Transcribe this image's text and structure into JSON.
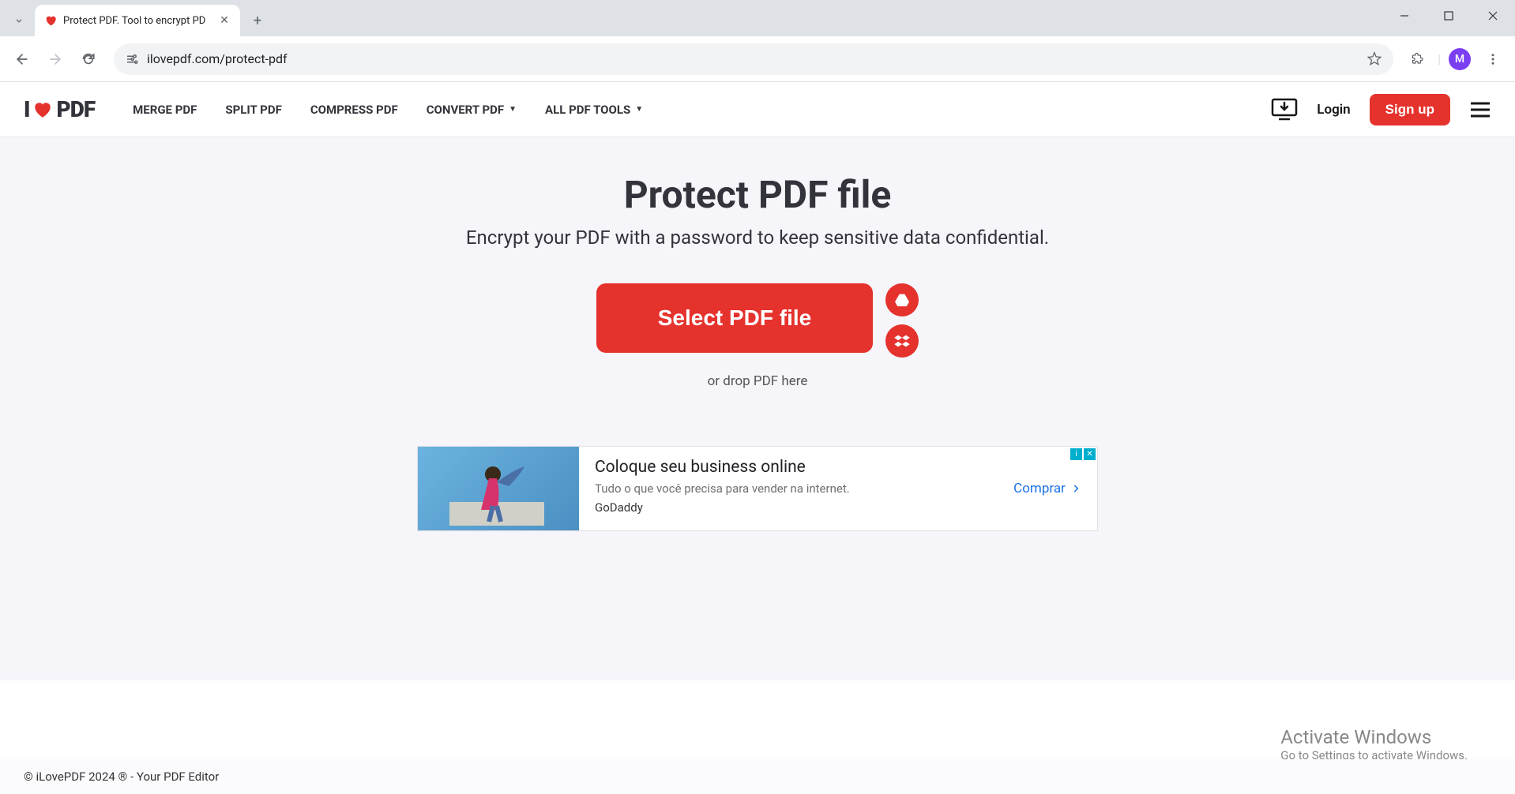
{
  "browser": {
    "tab_title": "Protect PDF. Tool to encrypt PD",
    "url": "ilovepdf.com/protect-pdf",
    "profile_initial": "M"
  },
  "header": {
    "logo_prefix": "I",
    "logo_suffix": "PDF",
    "nav": {
      "merge": "MERGE PDF",
      "split": "SPLIT PDF",
      "compress": "COMPRESS PDF",
      "convert": "CONVERT PDF",
      "alltools": "ALL PDF TOOLS"
    },
    "login": "Login",
    "signup": "Sign up"
  },
  "main": {
    "title": "Protect PDF file",
    "subtitle": "Encrypt your PDF with a password to keep sensitive data confidential.",
    "select_button": "Select PDF file",
    "drop_hint": "or drop PDF here"
  },
  "ad": {
    "title": "Coloque seu business online",
    "desc": "Tudo o que você precisa para vender na internet.",
    "brand": "GoDaddy",
    "cta": "Comprar"
  },
  "watermark": {
    "title": "Activate Windows",
    "sub": "Go to Settings to activate Windows."
  },
  "footer": {
    "copyright": "© iLovePDF 2024 ® - Your PDF Editor"
  }
}
